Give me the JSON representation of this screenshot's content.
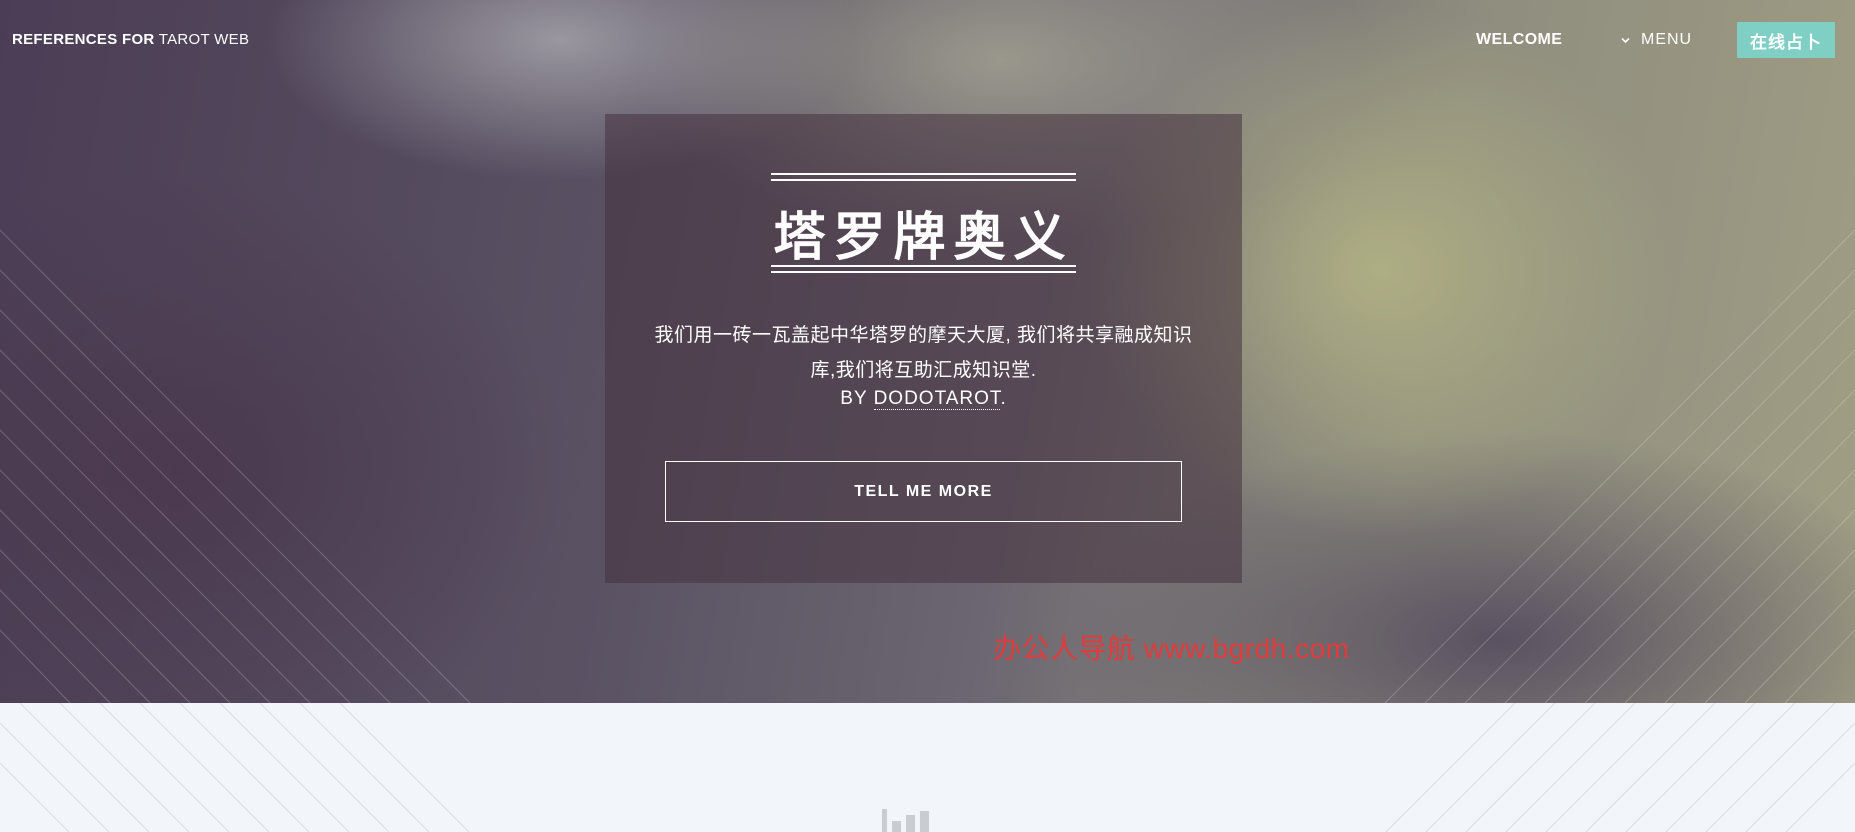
{
  "header": {
    "brand_bold": "REFERENCES FOR",
    "brand_light": "TAROT WEB",
    "nav_welcome": "WELCOME",
    "nav_menu": "MENU",
    "cta": "在线占卜"
  },
  "hero": {
    "title": "塔罗牌奥义",
    "description": "我们用一砖一瓦盖起中华塔罗的摩天大厦, 我们将共享融成知识库,我们将互助汇成知识堂.",
    "by_prefix": "BY",
    "by_link": "DODOTAROT",
    "by_suffix": ".",
    "button_label": "TELL ME MORE"
  },
  "watermark": "办公人导航  www.bgrdh.com",
  "colors": {
    "accent": "#7fcfc5",
    "watermark": "#e23b3b",
    "lower_bg": "#f2f5f9"
  },
  "icons": {
    "menu": "chevron-down-icon",
    "lower": "bar-chart-icon"
  }
}
